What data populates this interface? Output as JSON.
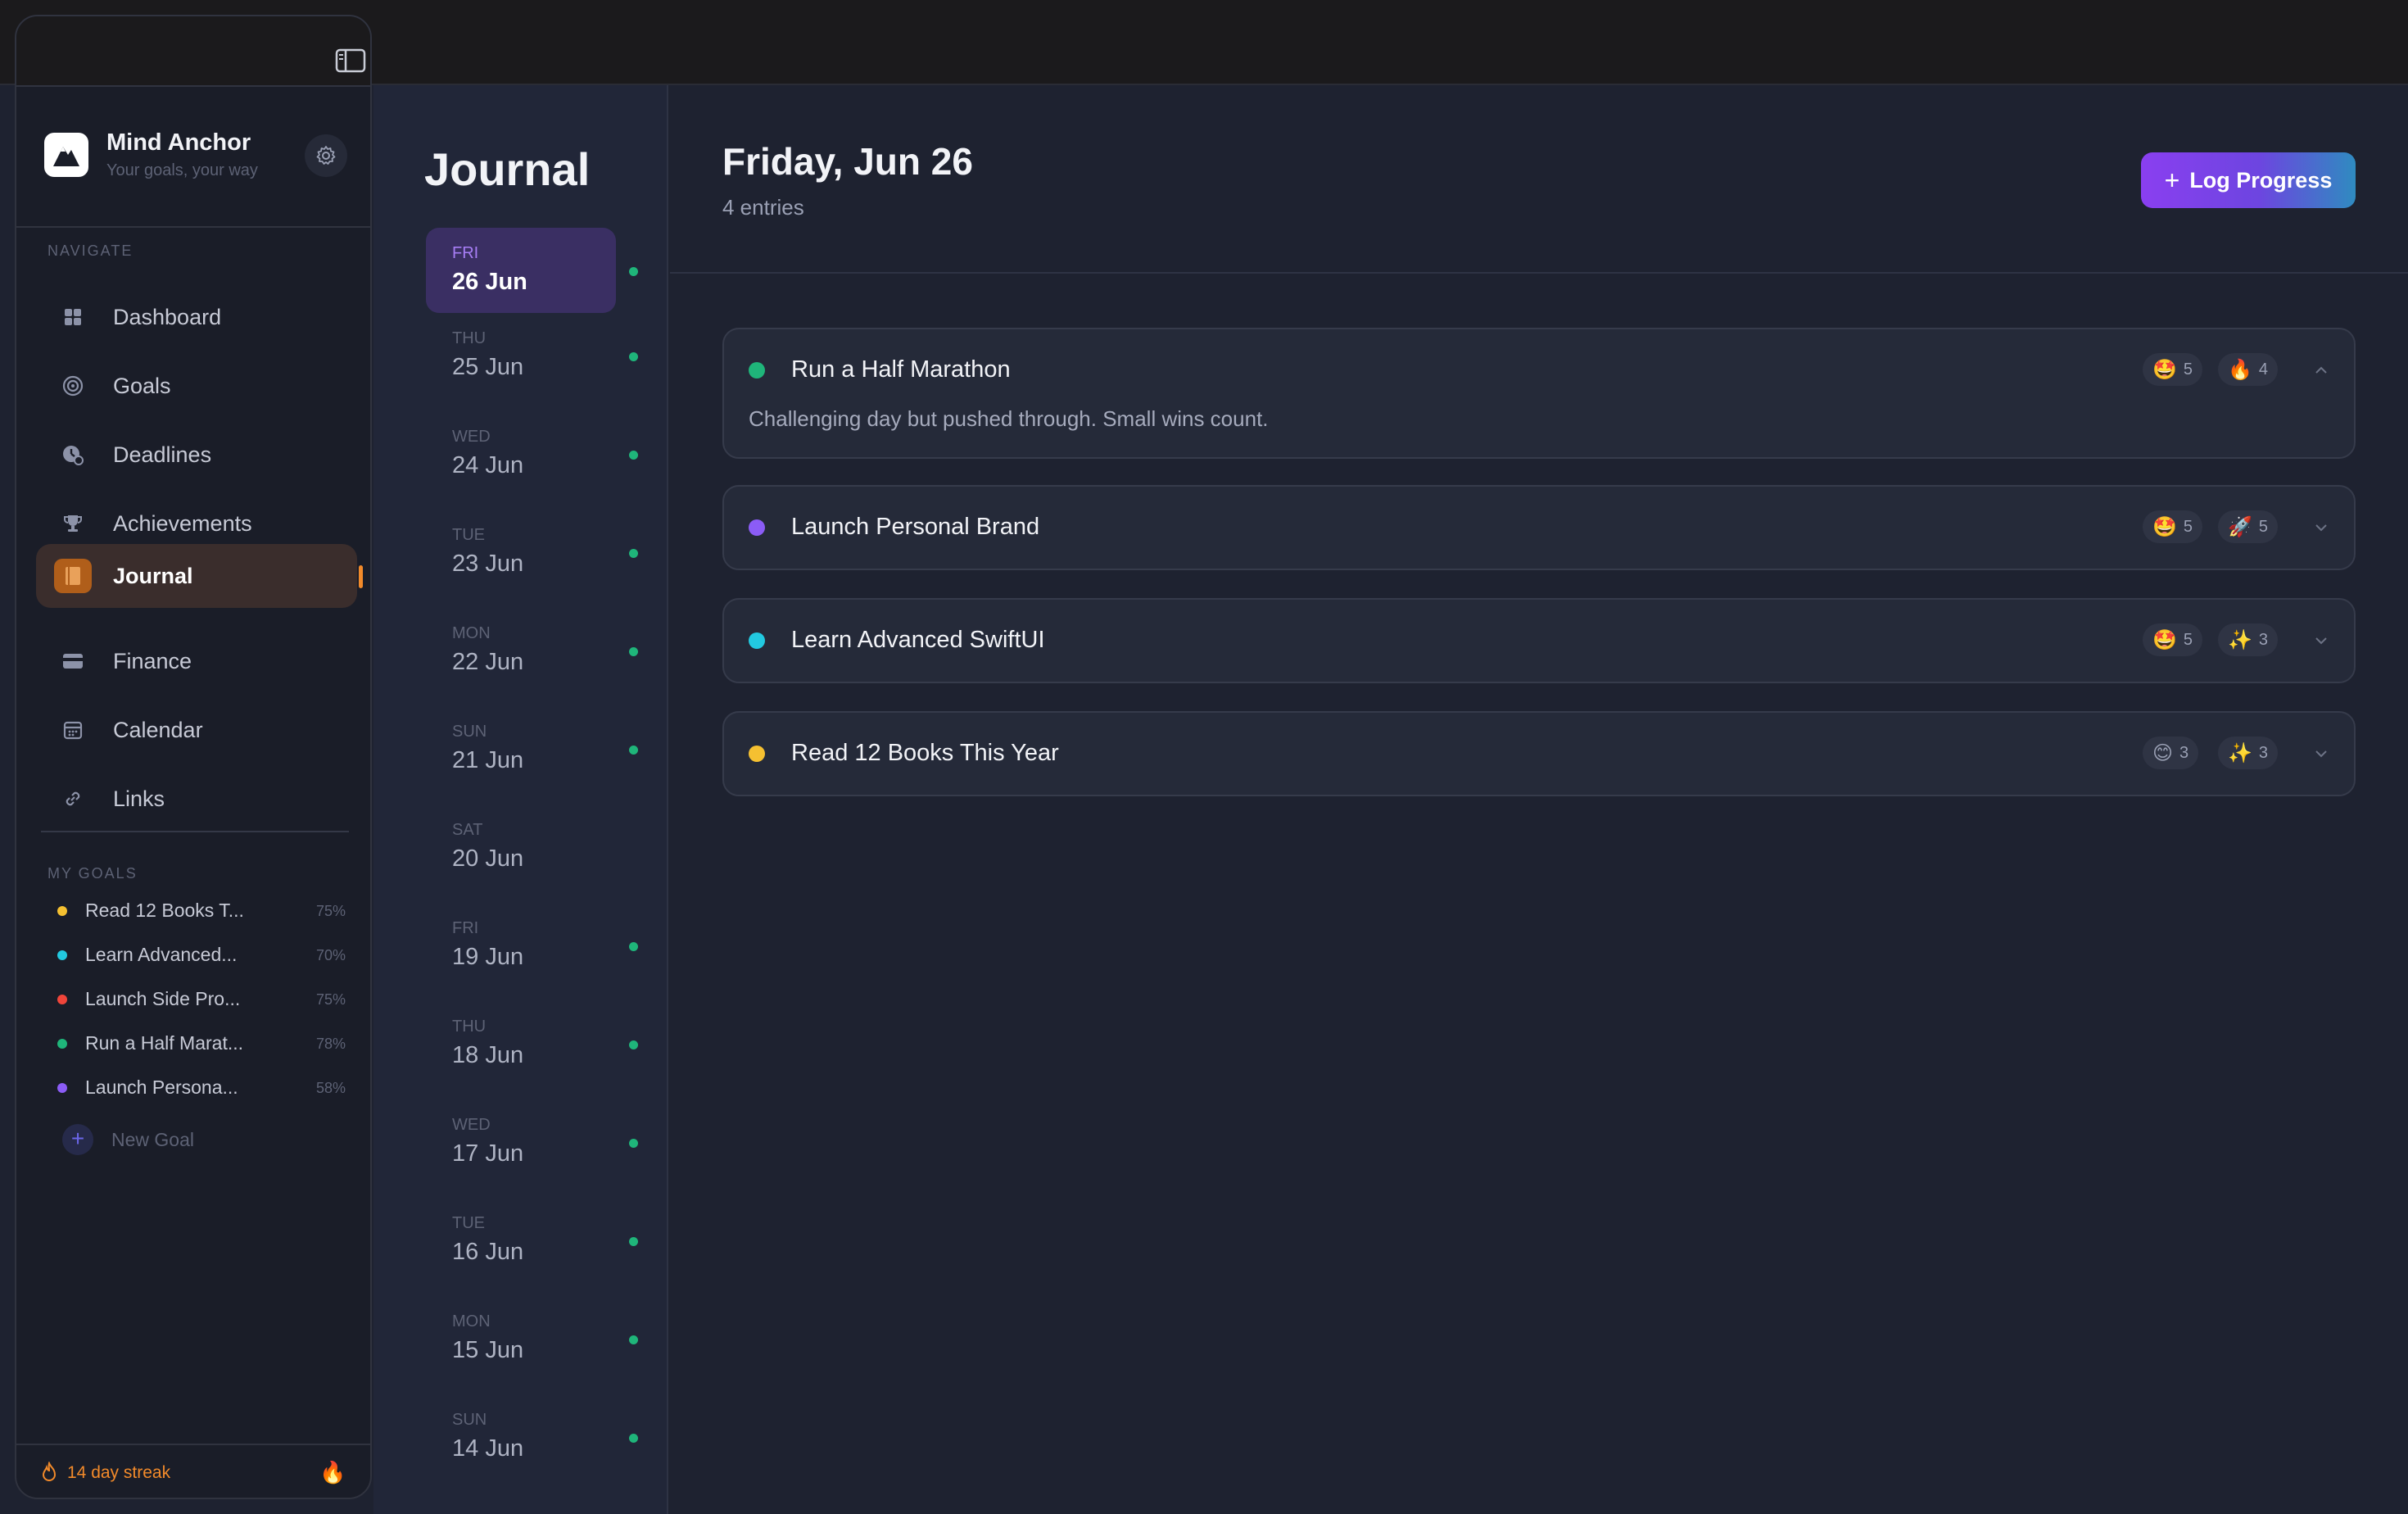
{
  "app": {
    "name": "Mind Anchor",
    "tagline": "Your goals, your way"
  },
  "nav": {
    "section_title": "NAVIGATE",
    "items": [
      {
        "label": "Dashboard",
        "icon": "grid-icon"
      },
      {
        "label": "Goals",
        "icon": "target-icon"
      },
      {
        "label": "Deadlines",
        "icon": "clock-icon"
      },
      {
        "label": "Achievements",
        "icon": "trophy-icon"
      },
      {
        "label": "Journal",
        "icon": "book-icon",
        "active": true
      },
      {
        "label": "Finance",
        "icon": "card-icon"
      },
      {
        "label": "Calendar",
        "icon": "calendar-icon"
      },
      {
        "label": "Links",
        "icon": "link-icon"
      }
    ]
  },
  "goals": {
    "section_title": "MY GOALS",
    "items": [
      {
        "name": "Read 12 Books T...",
        "pct": "75%",
        "color": "#f5c031"
      },
      {
        "name": "Learn Advanced...",
        "pct": "70%",
        "color": "#22c9e0"
      },
      {
        "name": "Launch Side Pro...",
        "pct": "75%",
        "color": "#f0453a"
      },
      {
        "name": "Run a Half Marat...",
        "pct": "78%",
        "color": "#1fb57a"
      },
      {
        "name": "Launch Persona...",
        "pct": "58%",
        "color": "#8b5cf6"
      }
    ],
    "new_goal_label": "New Goal"
  },
  "streak": {
    "text": "14 day streak"
  },
  "journal": {
    "title": "Journal",
    "days": [
      {
        "dow": "FRI",
        "date": "26 Jun",
        "selected": true
      },
      {
        "dow": "THU",
        "date": "25 Jun"
      },
      {
        "dow": "WED",
        "date": "24 Jun"
      },
      {
        "dow": "TUE",
        "date": "23 Jun"
      },
      {
        "dow": "MON",
        "date": "22 Jun"
      },
      {
        "dow": "SUN",
        "date": "21 Jun"
      },
      {
        "dow": "SAT",
        "date": "20 Jun",
        "no_dot": true
      },
      {
        "dow": "FRI",
        "date": "19 Jun"
      },
      {
        "dow": "THU",
        "date": "18 Jun"
      },
      {
        "dow": "WED",
        "date": "17 Jun"
      },
      {
        "dow": "TUE",
        "date": "16 Jun"
      },
      {
        "dow": "MON",
        "date": "15 Jun"
      },
      {
        "dow": "SUN",
        "date": "14 Jun"
      }
    ]
  },
  "main": {
    "date_heading": "Friday, Jun 26",
    "entries_count": "4 entries",
    "log_button": "Log Progress",
    "entries": [
      {
        "title": "Run a Half Marathon",
        "color": "#1fb57a",
        "mood": "5",
        "mood_emoji": "🤩",
        "energy": "4",
        "energy_emoji": "🔥",
        "expanded": true,
        "note": "Challenging day but pushed through. Small wins count."
      },
      {
        "title": "Launch Personal Brand",
        "color": "#8b5cf6",
        "mood": "5",
        "mood_emoji": "🤩",
        "energy": "5",
        "energy_emoji": "🚀"
      },
      {
        "title": "Learn Advanced SwiftUI",
        "color": "#22c9e0",
        "mood": "5",
        "mood_emoji": "🤩",
        "energy": "3",
        "energy_emoji": "✨"
      },
      {
        "title": "Read 12 Books This Year",
        "color": "#f5c031",
        "mood": "3",
        "mood_emoji": "😊",
        "energy": "3",
        "energy_emoji": "✨"
      }
    ]
  }
}
